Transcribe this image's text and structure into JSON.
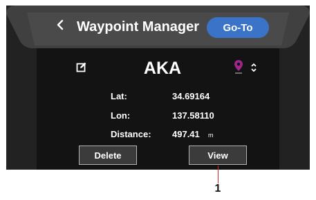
{
  "header": {
    "title": "Waypoint Manager",
    "back_icon": "chevron-left-icon",
    "goto_label": "Go-To"
  },
  "waypoint": {
    "name": "AKA",
    "edit_icon": "edit-icon",
    "marker_icon": "map-pin-icon",
    "marker_color": "#a0268a",
    "sort_icon": "up-down-chevron-icon"
  },
  "details": {
    "lat_label": "Lat:",
    "lat_value": "34.69164",
    "lon_label": "Lon:",
    "lon_value": "137.58110",
    "distance_label": "Distance:",
    "distance_value": "497.41",
    "distance_unit": "m"
  },
  "actions": {
    "delete_label": "Delete",
    "view_label": "View"
  },
  "callout": {
    "number": "1",
    "color": "#d4292b"
  },
  "colors": {
    "accent": "#3a73c8",
    "bezel": "#222222",
    "header": "#404040",
    "screen": "#131313"
  }
}
